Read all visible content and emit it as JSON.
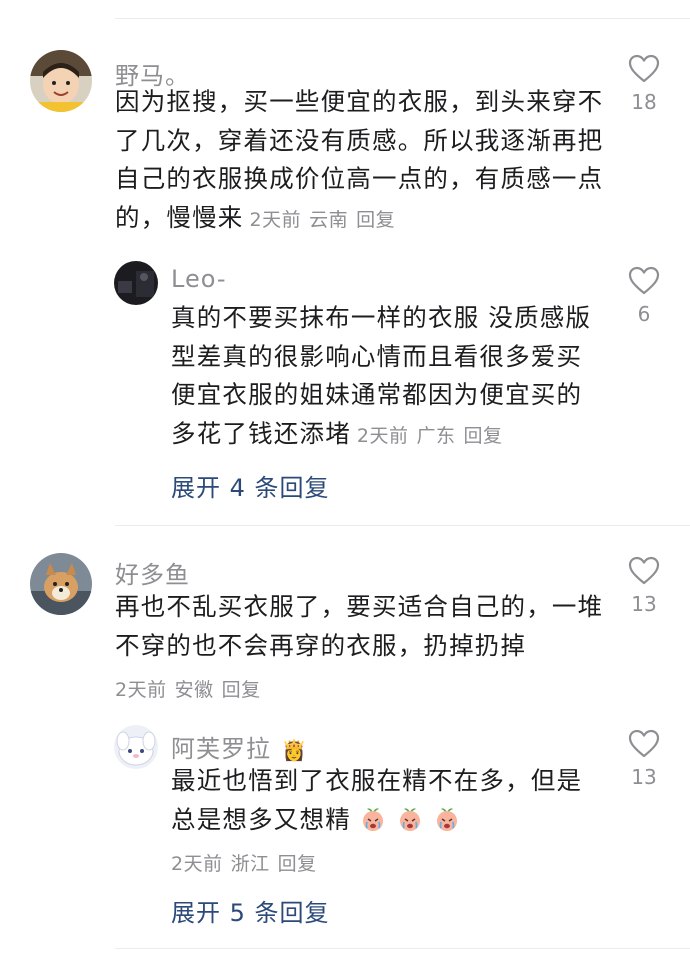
{
  "comments": [
    {
      "username": "野马。",
      "lines": [
        "因为抠搜，买一些便宜的衣服，到头来穿不",
        "了几次，穿着还没有质感。所以我逐渐再把",
        "自己的衣服换成价位高一点的，有质感一点",
        "的，慢慢来"
      ],
      "time": "2天前",
      "location": "云南",
      "reply_label": "回复",
      "likes": "18",
      "reply": {
        "username": "Leo-",
        "lines": [
          "真的不要买抹布一样的衣服 没质感版",
          "型差真的很影响心情而且看很多爱买",
          "便宜衣服的姐妹通常都因为便宜买的",
          "多花了钱还添堵"
        ],
        "time": "2天前",
        "location": "广东",
        "reply_label": "回复",
        "likes": "6"
      },
      "expand_label": "展开 4 条回复"
    },
    {
      "username": "好多鱼",
      "lines": [
        "再也不乱买衣服了，要买适合自己的，一堆",
        "不穿的也不会再穿的衣服，扔掉扔掉"
      ],
      "time": "2天前",
      "location": "安徽",
      "reply_label": "回复",
      "likes": "13",
      "reply": {
        "username": "阿芙罗拉",
        "badge": "👸",
        "lines": [
          "最近也悟到了衣服在精不在多，但是",
          "总是想多又想精"
        ],
        "time": "2天前",
        "location": "浙江",
        "reply_label": "回复",
        "likes": "13"
      },
      "expand_label": "展开 5 条回复"
    }
  ],
  "icons": {
    "like": "heart-outline-icon",
    "emoji": "crying-peach-emoji-icon"
  },
  "colors": {
    "text": "#1d1d1f",
    "muted": "#8e8e93",
    "link": "#2b4a7a"
  }
}
